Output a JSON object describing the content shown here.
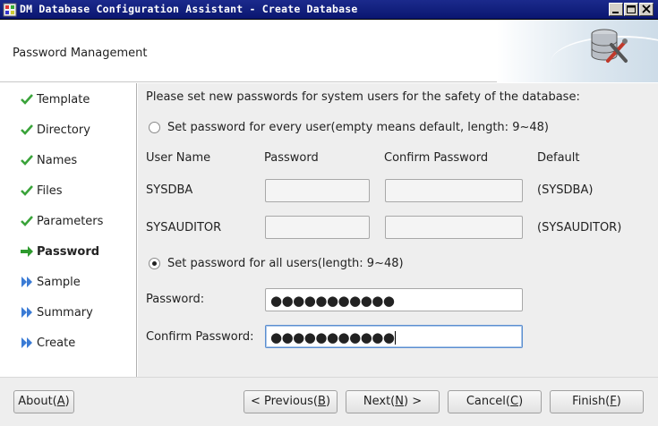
{
  "window": {
    "title": "DM Database Configuration Assistant - Create Database"
  },
  "header": {
    "title": "Password Management"
  },
  "sidebar": {
    "steps": [
      {
        "label": "Template",
        "state": "done"
      },
      {
        "label": "Directory",
        "state": "done"
      },
      {
        "label": "Names",
        "state": "done"
      },
      {
        "label": "Files",
        "state": "done"
      },
      {
        "label": "Parameters",
        "state": "done"
      },
      {
        "label": "Password",
        "state": "current"
      },
      {
        "label": "Sample",
        "state": "pending"
      },
      {
        "label": "Summary",
        "state": "pending"
      },
      {
        "label": "Create",
        "state": "pending"
      }
    ]
  },
  "main": {
    "intro": "Please set new passwords for system users for the safety of the database:",
    "option_every_user": {
      "label": "Set password for every user(empty means default, length: 9~48)",
      "selected": false
    },
    "columns": {
      "user_name": "User Name",
      "password": "Password",
      "confirm_password": "Confirm Password",
      "default": "Default"
    },
    "users": [
      {
        "name": "SYSDBA",
        "password": "",
        "confirm": "",
        "default": "(SYSDBA)"
      },
      {
        "name": "SYSAUDITOR",
        "password": "",
        "confirm": "",
        "default": "(SYSAUDITOR)"
      }
    ],
    "option_all_users": {
      "label": "Set password for all users(length: 9~48)",
      "selected": true
    },
    "password_label": "Password:",
    "password_value": "●●●●●●●●●●●",
    "confirm_label": "Confirm Password:",
    "confirm_value": "●●●●●●●●●●●"
  },
  "buttons": {
    "about": {
      "text": "About(",
      "mnemonic": "A",
      "close": ")"
    },
    "previous": {
      "text": "< Previous(",
      "mnemonic": "B",
      "close": ")"
    },
    "next": {
      "text": "Next(",
      "mnemonic": "N",
      "close": ") >"
    },
    "cancel": {
      "text": "Cancel(",
      "mnemonic": "C",
      "close": ")"
    },
    "finish": {
      "text": "Finish(",
      "mnemonic": "F",
      "close": ")"
    }
  },
  "colors": {
    "titlebar": "#0a1670",
    "check": "#3aa33a",
    "current_arrow": "#2e9a2e",
    "pending_arrow": "#3a7bd5"
  }
}
